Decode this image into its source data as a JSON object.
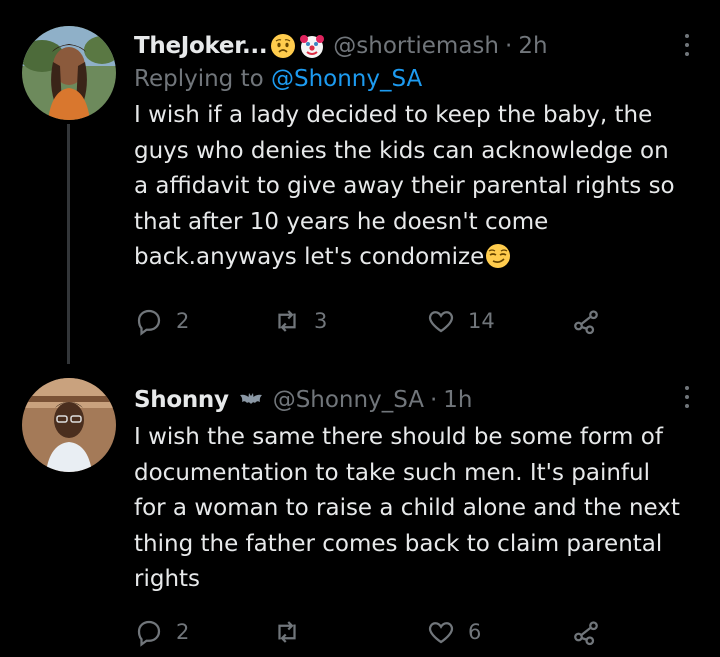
{
  "tweets": [
    {
      "display_name": "TheJoker...",
      "emojis": [
        "worried-face-icon",
        "clown-face-icon"
      ],
      "handle": "@shortiemash",
      "separator": "·",
      "time": "2h",
      "replying_prefix": "Replying to",
      "replying_to": "@Shonny_SA",
      "text": "I wish if a lady decided to keep the baby, the guys who denies the kids can acknowledge on a affidavit to give away their parental rights so that after 10 years he doesn't come back.anyways let's condomize",
      "text_emoji": "smirking-face-icon",
      "replies": "2",
      "retweets": "3",
      "likes": "14"
    },
    {
      "display_name": "Shonny",
      "badge_icon": "bat-icon",
      "handle": "@Shonny_SA",
      "separator": "·",
      "time": "1h",
      "text": "I wish the same there should be some form of documentation to take such men. It's painful for a woman to raise a child alone and the next thing the father comes back to claim parental rights",
      "replies": "2",
      "retweets": "",
      "likes": "6"
    }
  ],
  "colors": {
    "background": "#000000",
    "primary_text": "#e7e9ea",
    "secondary_text": "#71767b",
    "link": "#1d9bf0",
    "thread_line": "#333639"
  }
}
